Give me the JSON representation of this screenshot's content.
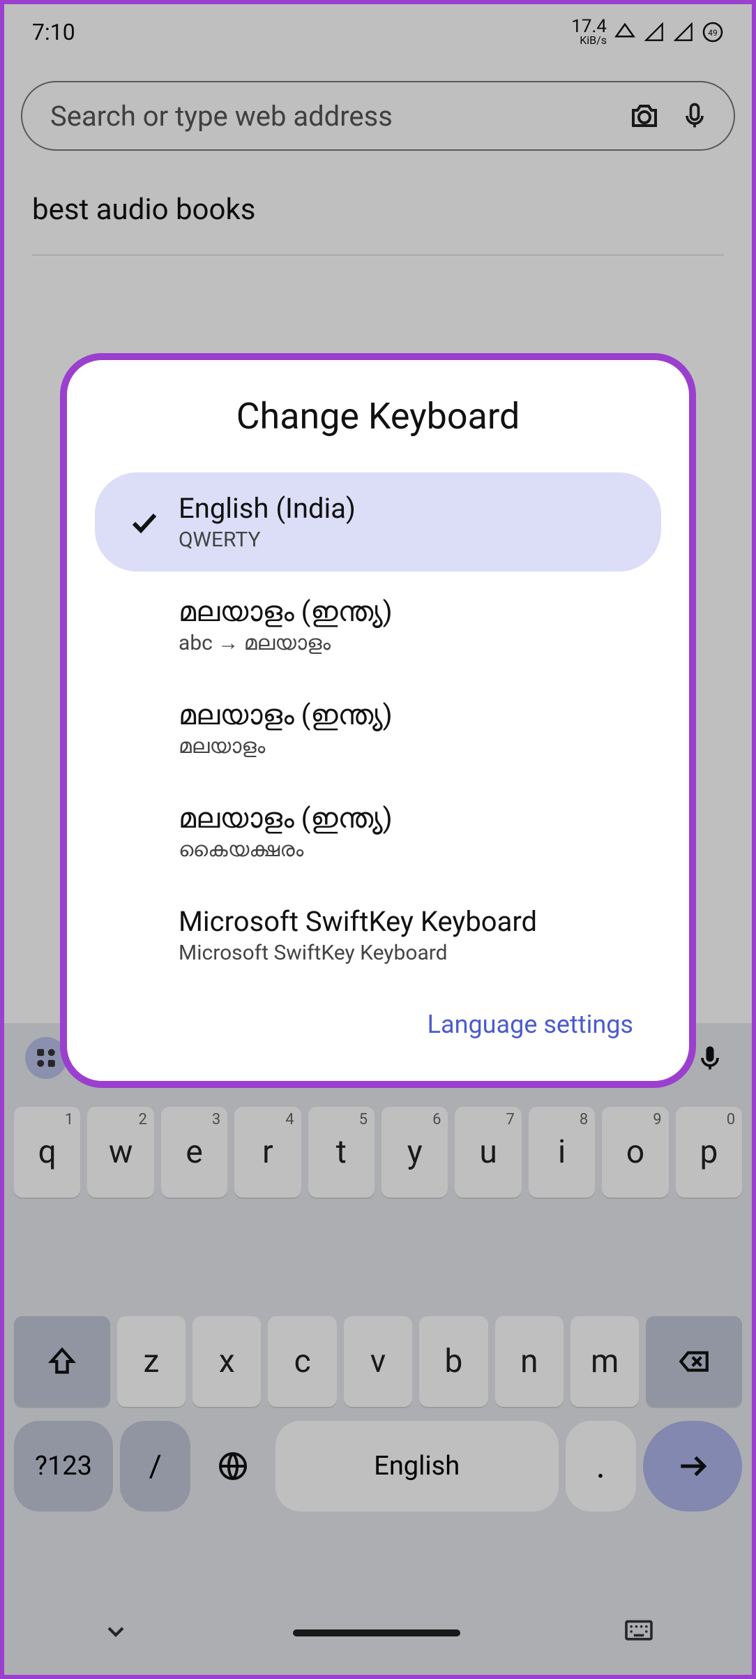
{
  "status": {
    "time": "7:10",
    "net_speed_value": "17.4",
    "net_speed_unit": "KiB/s",
    "battery": "49"
  },
  "search": {
    "placeholder": "Search or type web address"
  },
  "suggestion": "best audio books",
  "modal": {
    "title": "Change Keyboard",
    "items": [
      {
        "label": "English (India)",
        "sub": "QWERTY",
        "selected": true
      },
      {
        "label": "മലയാളം (ഇന്ത്യ)",
        "sub": "abc → മലയാളം",
        "selected": false
      },
      {
        "label": "മലയാളം (ഇന്ത്യ)",
        "sub": "മലയാളം",
        "selected": false
      },
      {
        "label": "മലയാളം (ഇന്ത്യ)",
        "sub": "കൈയക്ഷരം",
        "selected": false
      },
      {
        "label": "Microsoft SwiftKey Keyboard",
        "sub": "Microsoft SwiftKey Keyboard",
        "selected": false
      }
    ],
    "settings_label": "Language settings"
  },
  "keyboard": {
    "row1": [
      "q",
      "w",
      "e",
      "r",
      "t",
      "y",
      "u",
      "i",
      "o",
      "p"
    ],
    "row1_super": [
      "1",
      "2",
      "3",
      "4",
      "5",
      "6",
      "7",
      "8",
      "9",
      "0"
    ],
    "row3": [
      "z",
      "x",
      "c",
      "v",
      "b",
      "n",
      "m"
    ],
    "sym_label": "?123",
    "slash_label": "/",
    "space_label": "English",
    "period_label": "."
  }
}
